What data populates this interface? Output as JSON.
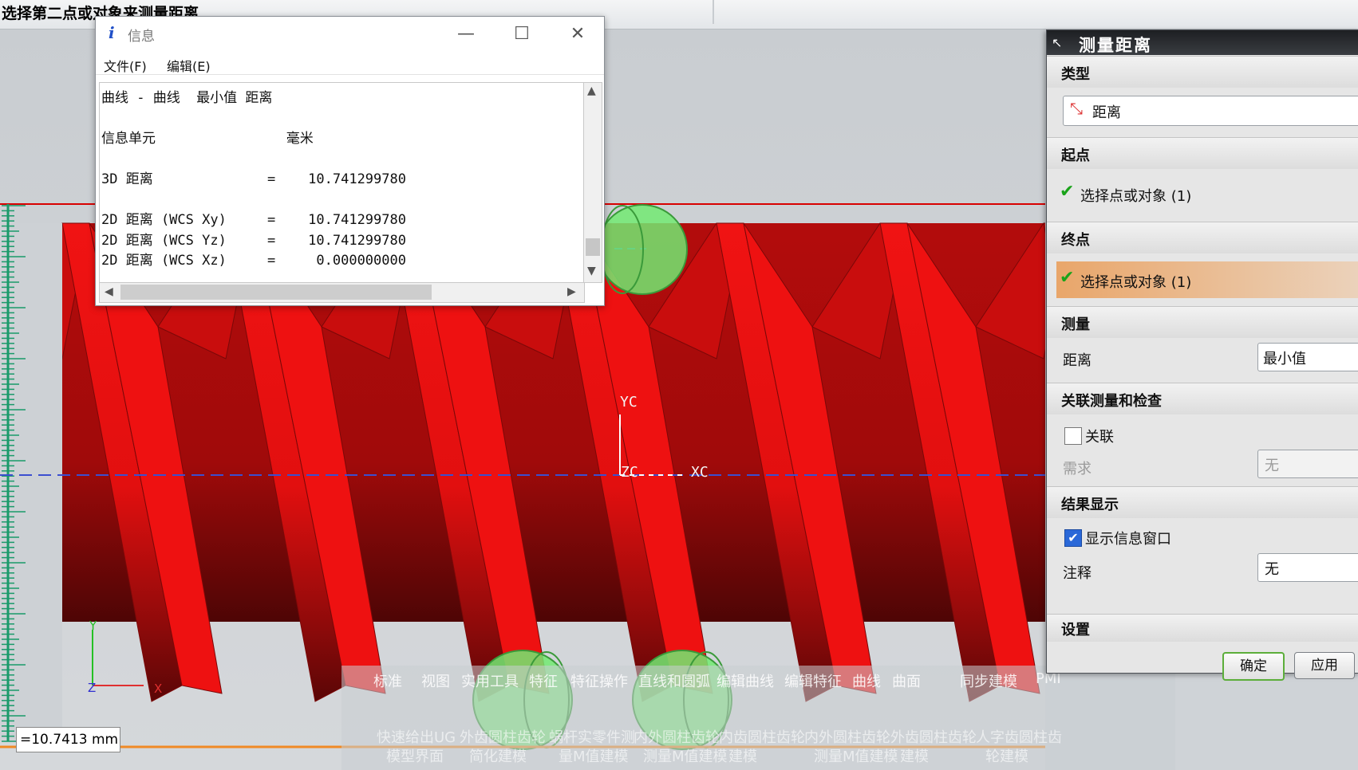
{
  "status_prompt": "选择第二点或对象来测量距离",
  "info_window": {
    "title": "信息",
    "menu": [
      "文件(F)",
      "编辑(E)"
    ],
    "lines": [
      "曲线 - 曲线  最小值 距离",
      "",
      "信息单元                毫米",
      "",
      "3D 距离              =    10.741299780",
      "",
      "2D 距离 (WCS Xy)     =    10.741299780",
      "2D 距离 (WCS Yz)     =    10.741299780",
      "2D 距离 (WCS Xz)     =     0.000000000"
    ],
    "minimize_icon": "minimize-icon",
    "maximize_icon": "maximize-icon",
    "close_icon": "close-icon"
  },
  "dialog": {
    "title": "测量距离",
    "sections": {
      "type": {
        "header": "类型",
        "value": "距离"
      },
      "start": {
        "header": "起点",
        "select_label": "选择点或对象 (1)"
      },
      "end": {
        "header": "终点",
        "select_label": "选择点或对象 (1)"
      },
      "measure": {
        "header": "测量",
        "distance_label": "距离",
        "distance_value": "最小值"
      },
      "assoc": {
        "header": "关联测量和检查",
        "assoc_label": "关联",
        "assoc_checked": false,
        "need_label": "需求",
        "need_value": "无"
      },
      "result": {
        "header": "结果显示",
        "show_info_label": "显示信息窗口",
        "show_info_checked": true,
        "note_label": "注释",
        "note_value": "无"
      },
      "settings": {
        "header": "设置"
      }
    },
    "ok_label": "确定",
    "apply_label": "应用"
  },
  "viewport": {
    "wcs_labels": {
      "yc": "YC",
      "zc": "ZC",
      "xc": "XC"
    },
    "abs_labels": {
      "y": "Y",
      "z": "Z",
      "x": "X"
    },
    "distance_readout": "=10.7413 mm",
    "colors": {
      "thread": "#ee1111",
      "sphere": "#6de66d",
      "axis_dash": "#3b4fd0",
      "ruler": "#1a9a6a"
    }
  },
  "toolbar": {
    "tabs": [
      "标准",
      "视图",
      "实用工具",
      "特征",
      "特征操作",
      "直线和圆弧",
      "编辑曲线",
      "编辑特征",
      "曲线",
      "曲面",
      "同步建模",
      "PMI"
    ],
    "items_row1": [
      "快速给出UG",
      "外齿圆柱齿轮",
      "蜗杆实零件测",
      "内外圆柱齿轮",
      "内齿圆柱齿轮",
      "内外圆柱齿轮",
      "外齿圆柱齿轮",
      "人字齿圆柱齿"
    ],
    "items_row2": [
      "模型界面",
      "简化建模",
      "量M值建模",
      "测量M值建模",
      "建模",
      "测量M值建模",
      "建模",
      "轮建模"
    ]
  }
}
